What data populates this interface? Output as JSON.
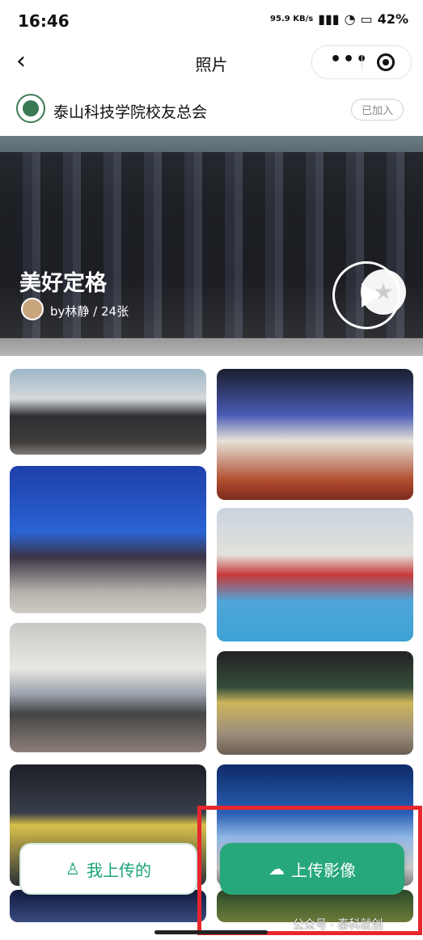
{
  "status": {
    "time": "16:46",
    "net_speed": "95.9 KB/s",
    "battery": "42%"
  },
  "nav": {
    "back": "‹",
    "title": "照片"
  },
  "group": {
    "name": "泰山科技学院校友总会",
    "joined_badge": "已加入"
  },
  "hero": {
    "title": "美好定格",
    "subtitle": "by林静 / 24张"
  },
  "actions": {
    "my_uploads": "我上传的",
    "upload": "上传影像"
  },
  "watermark": "公众号 · 泰科就创",
  "colors": {
    "accent": "#26a87b",
    "highlight_box": "#e8262d"
  }
}
